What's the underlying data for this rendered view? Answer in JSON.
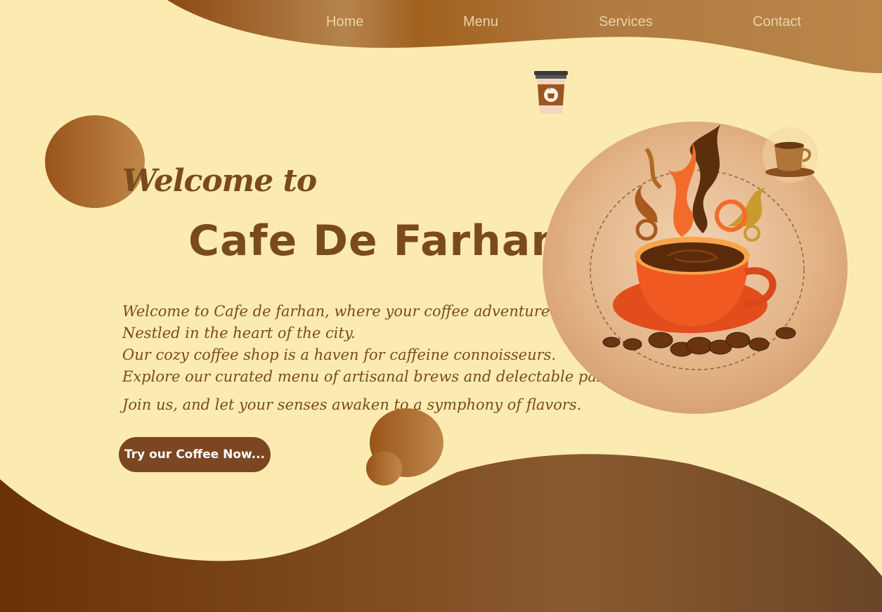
{
  "nav": {
    "items": [
      {
        "label": "Home"
      },
      {
        "label": "Menu"
      },
      {
        "label": "Services"
      },
      {
        "label": "Contact"
      }
    ]
  },
  "hero": {
    "welcome": "Welcome to",
    "title": "Cafe De Farhan!",
    "intro_lines": [
      "Welcome to Cafe de farhan, where your coffee adventure begins!",
      "Nestled in the heart of the city.",
      "Our cozy coffee shop is a haven for caffeine connoisseurs.",
      "Explore our curated menu of artisanal brews and delectable pastries.",
      "Join us, and let your senses awaken to a symphony of flavors."
    ],
    "cta_label": "Try our Coffee Now..."
  },
  "colors": {
    "background": "#FCEBB0",
    "brand_brown": "#7A4A1F",
    "cta_background": "#7C4622",
    "nav_text": "#EBD2A5"
  },
  "icons": [
    "takeaway-coffee-cup-icon",
    "coffee-cup-saucer-icon",
    "coffee-cup-illustration"
  ]
}
